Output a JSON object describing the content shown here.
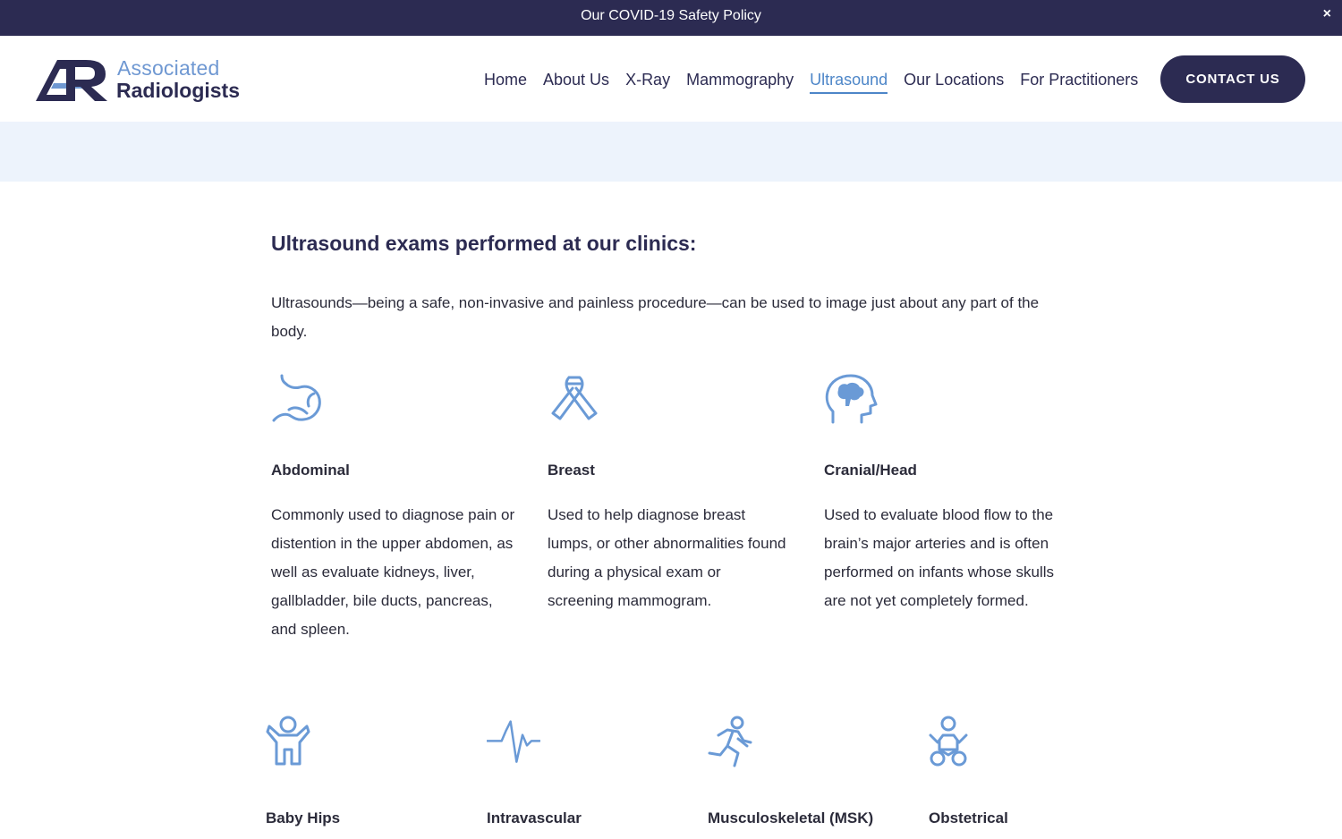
{
  "banner": {
    "text": "Our COVID-19 Safety Policy",
    "close_label": "×"
  },
  "logo": {
    "line1": "Associated",
    "line2": "Radiologists"
  },
  "nav": {
    "items": [
      {
        "label": "Home"
      },
      {
        "label": "About Us"
      },
      {
        "label": "X-Ray"
      },
      {
        "label": "Mammography"
      },
      {
        "label": "Ultrasound",
        "active": true
      },
      {
        "label": "Our Locations"
      },
      {
        "label": "For Practitioners"
      }
    ],
    "contact_label": "CONTACT US"
  },
  "colors": {
    "brand_navy": "#2c2b52",
    "accent_blue": "#4d86c8",
    "icon_blue": "#6a9ad6",
    "band_bg": "#edf3fc"
  },
  "content": {
    "title": "Ultrasound exams performed at our clinics:",
    "intro": "Ultrasounds—being a safe, non-invasive and painless procedure—can be used to image just about any part of the body.",
    "exams": [
      {
        "icon": "stomach-icon",
        "title": "Abdominal",
        "description": "Commonly used to diagnose pain or distention in the upper abdomen, as well as evaluate kidneys, liver, gallbladder, bile ducts, pancreas, and spleen."
      },
      {
        "icon": "ribbon-icon",
        "title": "Breast",
        "description": "Used to help diagnose breast lumps, or other abnormalities found during a physical exam or screening mammogram."
      },
      {
        "icon": "head-brain-icon",
        "title": "Cranial/Head",
        "description": "Used to evaluate blood flow to the brain’s major arteries and is often performed on infants whose skulls are not yet completely formed."
      },
      {
        "icon": "child-icon",
        "title": "Baby Hips"
      },
      {
        "icon": "heartbeat-icon",
        "title": "Intravascular"
      },
      {
        "icon": "running-person-icon",
        "title": "Musculoskeletal (MSK)"
      },
      {
        "icon": "baby-icon",
        "title": "Obstetrical"
      }
    ]
  }
}
